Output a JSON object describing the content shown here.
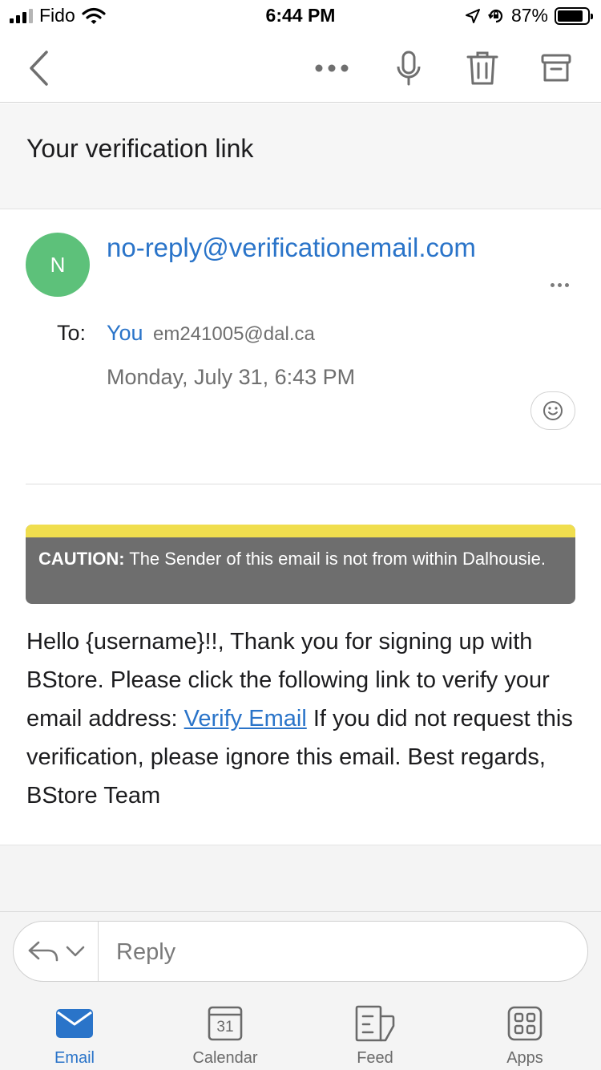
{
  "status_bar": {
    "carrier": "Fido",
    "time": "6:44 PM",
    "battery_percent": "87%",
    "battery_level": 0.87,
    "icons": [
      "signal-icon",
      "wifi-icon",
      "location-arrow-icon",
      "orientation-lock-icon",
      "battery-icon"
    ]
  },
  "toolbar": {
    "icons": [
      "back-icon",
      "more-icon",
      "microphone-icon",
      "trash-icon",
      "archive-icon"
    ]
  },
  "email": {
    "subject": "Your verification link",
    "avatar_initial": "N",
    "sender": "no-reply@verificationemail.com",
    "to_label": "To:",
    "to_name": "You",
    "to_email": "em241005@dal.ca",
    "date": "Monday, July 31, 6:43 PM",
    "caution_label": "CAUTION:",
    "caution_text": " The Sender of this email is not from within Dalhousie.",
    "body_before_link": "Hello {username}!!, Thank you for signing up with BStore. Please click the following link to verify your email address: ",
    "link_text": "Verify Email",
    "body_after_link": " If you did not request this verification, please ignore this email. Best regards, BStore Team"
  },
  "reply": {
    "placeholder": "Reply"
  },
  "tabs": [
    {
      "label": "Email",
      "icon": "mail-icon",
      "active": true
    },
    {
      "label": "Calendar",
      "icon": "calendar-icon",
      "day": "31",
      "active": false
    },
    {
      "label": "Feed",
      "icon": "feed-icon",
      "active": false
    },
    {
      "label": "Apps",
      "icon": "apps-icon",
      "active": false
    }
  ],
  "colors": {
    "accent": "#2a74c9",
    "avatar": "#5dc17a",
    "caution_stripe": "#f0de4e",
    "caution_bg": "#6e6e6e"
  }
}
